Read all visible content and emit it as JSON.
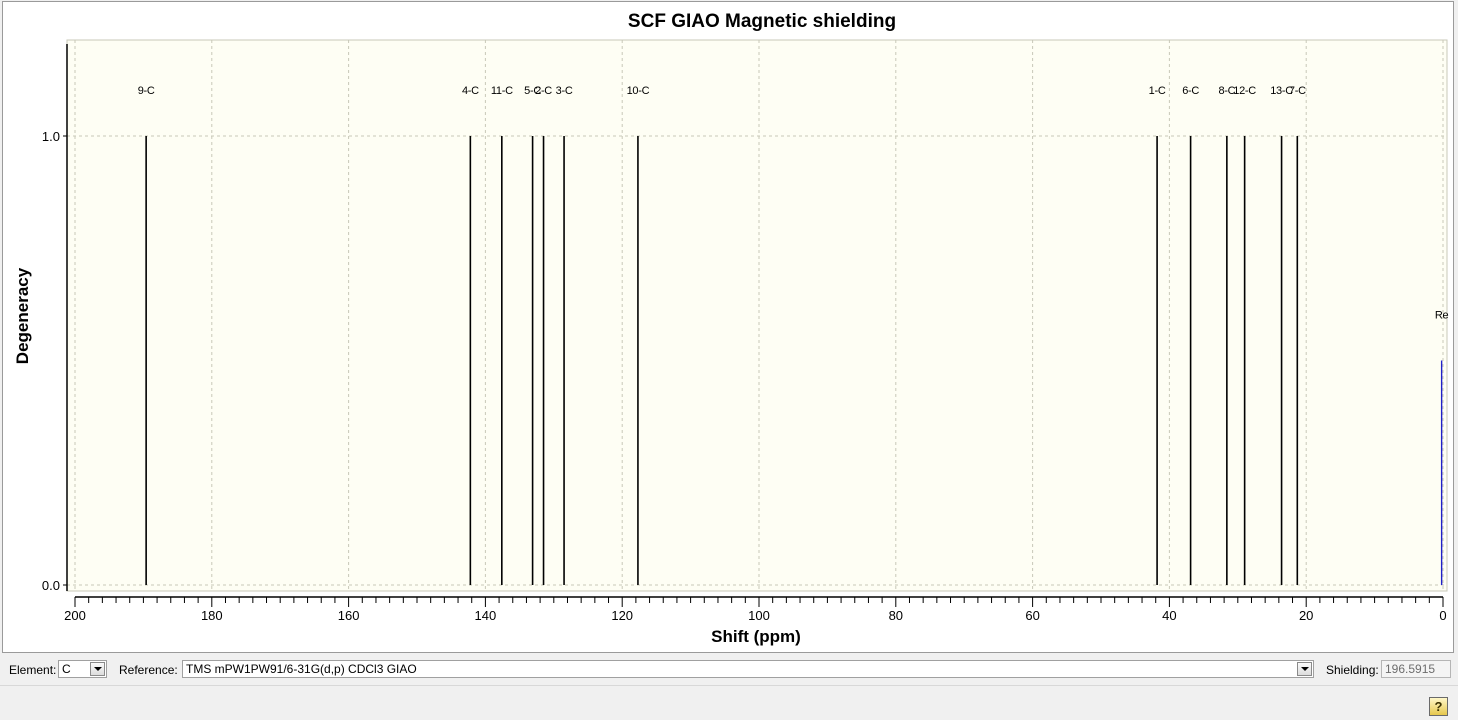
{
  "chart_data": {
    "type": "stem",
    "title": "SCF GIAO Magnetic shielding",
    "xlabel": "Shift (ppm)",
    "ylabel": "Degeneracy",
    "xlim": [
      200,
      0
    ],
    "x_reversed": true,
    "ylim": [
      0,
      1
    ],
    "x_ticks": [
      "200",
      "180",
      "160",
      "140",
      "120",
      "100",
      "80",
      "60",
      "40",
      "20",
      "0"
    ],
    "y_ticks": [
      "0.0",
      "1.0"
    ],
    "grid": true,
    "series": [
      {
        "values": [
          {
            "label": "9-C",
            "x": 189.6,
            "y": 1
          },
          {
            "label": "4-C",
            "x": 142.2,
            "y": 1
          },
          {
            "label": "11-C",
            "x": 137.6,
            "y": 1
          },
          {
            "label": "5-C",
            "x": 133.1,
            "y": 1
          },
          {
            "label": "2-C",
            "x": 131.5,
            "y": 1
          },
          {
            "label": "3-C",
            "x": 128.5,
            "y": 1
          },
          {
            "label": "10-C",
            "x": 117.7,
            "y": 1
          },
          {
            "label": "1-C",
            "x": 41.8,
            "y": 1
          },
          {
            "label": "6-C",
            "x": 36.9,
            "y": 1
          },
          {
            "label": "8-C",
            "x": 31.6,
            "y": 1
          },
          {
            "label": "12-C",
            "x": 29.0,
            "y": 1
          },
          {
            "label": "13-C",
            "x": 23.6,
            "y": 1
          },
          {
            "label": "7-C",
            "x": 21.3,
            "y": 1
          }
        ],
        "color": "#000000"
      },
      {
        "values": [
          {
            "label": "Re",
            "x": 0.2,
            "y": 0.5
          }
        ],
        "color": "#2020c8"
      }
    ],
    "colors": {
      "plot_background": "#fefef4",
      "grid": "#c8c8b8",
      "reference_line": "#2020c8"
    }
  },
  "controls": {
    "element_label": "Element:",
    "element_value": "C",
    "reference_label": "Reference:",
    "reference_value": "TMS mPW1PW91/6-31G(d,p) CDCl3 GIAO",
    "shielding_label": "Shielding:",
    "shielding_value": "196.5915"
  },
  "footer": {
    "help_icon": "question-help-icon",
    "help_glyph": "?"
  }
}
